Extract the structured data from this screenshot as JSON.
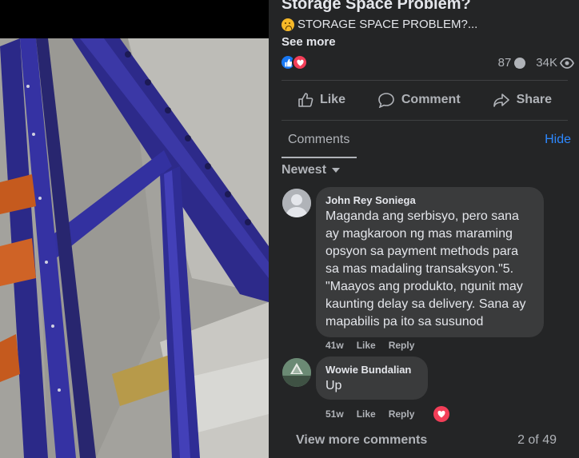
{
  "post": {
    "title": "Storage Space Problem?",
    "preview": "STORAGE SPACE PROBLEM?...",
    "see_more": "See more",
    "emoji_icon": "thinking-face-emoji",
    "reactions": [
      "like-reaction-icon",
      "love-reaction-icon"
    ],
    "comment_count": "87",
    "view_count": "34K"
  },
  "actions": {
    "like": "Like",
    "comment": "Comment",
    "share": "Share"
  },
  "comments_section": {
    "tab": "Comments",
    "hide": "Hide",
    "sort": "Newest",
    "comments": [
      {
        "author": "John Rey Soniega",
        "text": "Maganda ang serbisyo, pero sana ay magkaroon ng mas maraming opsyon sa payment methods para sa mas madaling transaksyon.\"5. \"Maayos ang produkto, ngunit may kaunting delay sa delivery. Sana ay mapabilis pa ito sa susunod",
        "time": "41w",
        "like": "Like",
        "reply": "Reply"
      },
      {
        "author": "Wowie Bundalian",
        "text": "Up",
        "time": "51w",
        "like": "Like",
        "reply": "Reply"
      }
    ],
    "view_more": "View more comments",
    "pagination": "2 of 49"
  },
  "colors": {
    "panel_bg": "#242526",
    "bubble_bg": "#3a3b3c",
    "link_blue": "#2d88ff",
    "like_blue": "#1877f2",
    "love_red": "#f33e58"
  }
}
